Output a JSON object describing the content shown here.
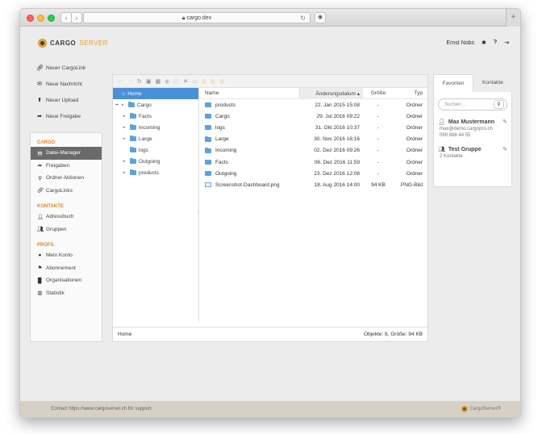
{
  "browser": {
    "url": "cargo.dev"
  },
  "header": {
    "brand_part1": "CARGO",
    "brand_part2": "SERVER",
    "user_name": "Ernst Nobs"
  },
  "actions": [
    {
      "label": "Neuer CargoLink",
      "icon": "link-icon"
    },
    {
      "label": "Neue Nachricht",
      "icon": "message-icon"
    },
    {
      "label": "Neuer Upload",
      "icon": "upload-icon"
    },
    {
      "label": "Neue Freigabe",
      "icon": "share-icon"
    }
  ],
  "menu": {
    "cargo_title": "CARGO",
    "cargo_items": [
      "Datei-Manager",
      "Freigaben",
      "Ordner Aktionen",
      "CargoLinks"
    ],
    "kontakte_title": "KONTAKTE",
    "kontakte_items": [
      "Adressbuch",
      "Gruppen"
    ],
    "profil_title": "PROFIL",
    "profil_items": [
      "Mein Konto",
      "Abonnement",
      "Organisationen",
      "Statistik"
    ]
  },
  "tree": {
    "root": "Home",
    "nodes": [
      "Cargo",
      "Facts",
      "Incoming",
      "Large",
      "logs",
      "Outgoing",
      "products"
    ]
  },
  "file_list": {
    "headers": {
      "name": "Name",
      "date": "Änderungsdatum",
      "size": "Größe",
      "type": "Typ"
    },
    "rows": [
      {
        "name": "products",
        "date": "22. Jan 2015 15:08",
        "size": "-",
        "type": "Ordner"
      },
      {
        "name": "Cargo",
        "date": "29. Jul 2016 09:22",
        "size": "-",
        "type": "Ordner"
      },
      {
        "name": "logs",
        "date": "31. Okt 2016 10:37",
        "size": "-",
        "type": "Ordner"
      },
      {
        "name": "Large",
        "date": "30. Nov 2016 16:16",
        "size": "-",
        "type": "Ordner"
      },
      {
        "name": "Incoming",
        "date": "02. Dez 2016 09:26",
        "size": "-",
        "type": "Ordner"
      },
      {
        "name": "Facts",
        "date": "06. Dez 2016 11:59",
        "size": "-",
        "type": "Ordner"
      },
      {
        "name": "Outgoing",
        "date": "23. Dez 2016 12:08",
        "size": "-",
        "type": "Ordner"
      },
      {
        "name": "Screenshot-Dashboard.png",
        "date": "18. Aug 2016 14:00",
        "size": "94 KB",
        "type": "PNG-Bild"
      }
    ]
  },
  "status": {
    "path": "Home",
    "summary": "Objekte: 8, Größe: 94 KB"
  },
  "right_panel": {
    "tabs": [
      "Favoriten",
      "Kontakte"
    ],
    "search_placeholder": "Suchen...",
    "contact": {
      "name": "Max Mustermann",
      "email": "max@demo.cargopro.ch",
      "phone": "099 888 44 55"
    },
    "group": {
      "name": "Test Gruppe",
      "count": "2 Kontakte"
    }
  },
  "footer": {
    "support_text": "Contact https://www.cargoserver.ch for support.",
    "brand": "CargoServer®"
  }
}
